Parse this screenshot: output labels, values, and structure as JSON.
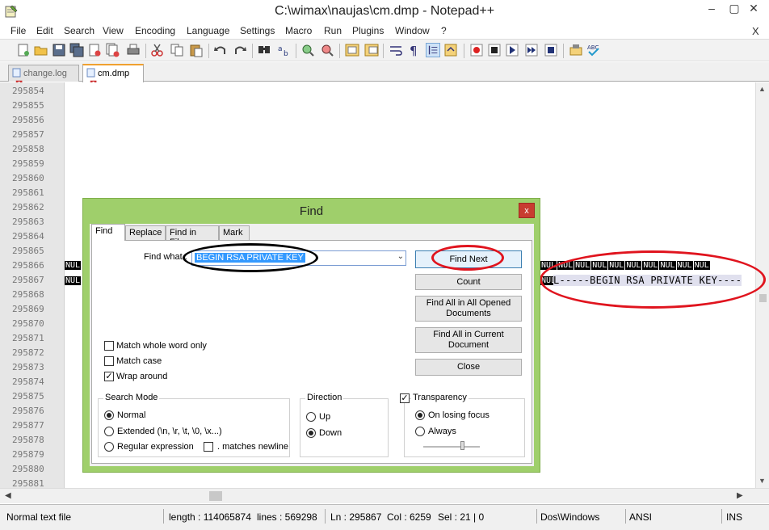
{
  "window": {
    "title": "C:\\wimax\\naujas\\cm.dmp - Notepad++",
    "minimize": "‒",
    "restore": "▢",
    "close": "✕"
  },
  "menu": {
    "items": [
      "File",
      "Edit",
      "Search",
      "View",
      "Encoding",
      "Language",
      "Settings",
      "Macro",
      "Run",
      "Plugins",
      "Window",
      "?"
    ],
    "close_doc": "X"
  },
  "tabs": [
    {
      "label": "change.log",
      "active": false
    },
    {
      "label": "cm.dmp",
      "active": true
    }
  ],
  "editor": {
    "line_numbers": [
      "295854",
      "295855",
      "295856",
      "295857",
      "295858",
      "295859",
      "295860",
      "295861",
      "295862",
      "295863",
      "295864",
      "295865",
      "295866",
      "295867",
      "295868",
      "295869",
      "295870",
      "295871",
      "295872",
      "295873",
      "295874",
      "295875",
      "295876",
      "295877",
      "295878",
      "295879",
      "295880",
      "295881"
    ],
    "nul_token": "NUL",
    "rsa_text": "L-----BEGIN RSA PRIVATE KEY----"
  },
  "statusbar": {
    "file_type": "Normal text file",
    "length": "length : 114065874",
    "lines": "lines : 569298",
    "ln": "Ln : 295867",
    "col": "Col : 6259",
    "sel": "Sel : 21 | 0",
    "eol": "Dos\\Windows",
    "encoding": "ANSI",
    "mode": "INS"
  },
  "find_dialog": {
    "title": "Find",
    "close": "x",
    "tabs": [
      "Find",
      "Replace",
      "Find in Files",
      "Mark"
    ],
    "find_what_label": "Find what :",
    "find_what_value": "BEGIN RSA PRIVATE KEY",
    "buttons": {
      "find_next": "Find Next",
      "count": "Count",
      "find_all_opened": "Find All in All Opened Documents",
      "find_all_current": "Find All in Current Document",
      "close": "Close"
    },
    "options": {
      "match_whole_word": {
        "label": "Match whole word only",
        "checked": false
      },
      "match_case": {
        "label": "Match case",
        "checked": false
      },
      "wrap_around": {
        "label": "Wrap around",
        "checked": true
      }
    },
    "search_mode": {
      "title": "Search Mode",
      "normal": "Normal",
      "extended": "Extended (\\n, \\r, \\t, \\0, \\x...)",
      "regex": "Regular expression",
      "matches_newline": ". matches newline",
      "selected": "Normal"
    },
    "direction": {
      "title": "Direction",
      "up": "Up",
      "down": "Down",
      "selected": "Down"
    },
    "transparency": {
      "title": "Transparency",
      "checked": true,
      "on_losing_focus": "On losing focus",
      "always": "Always",
      "selected": "On losing focus"
    }
  },
  "annotations": {
    "black_ellipse_color": "#000000",
    "red_ellipse_color": "#e0141e"
  }
}
